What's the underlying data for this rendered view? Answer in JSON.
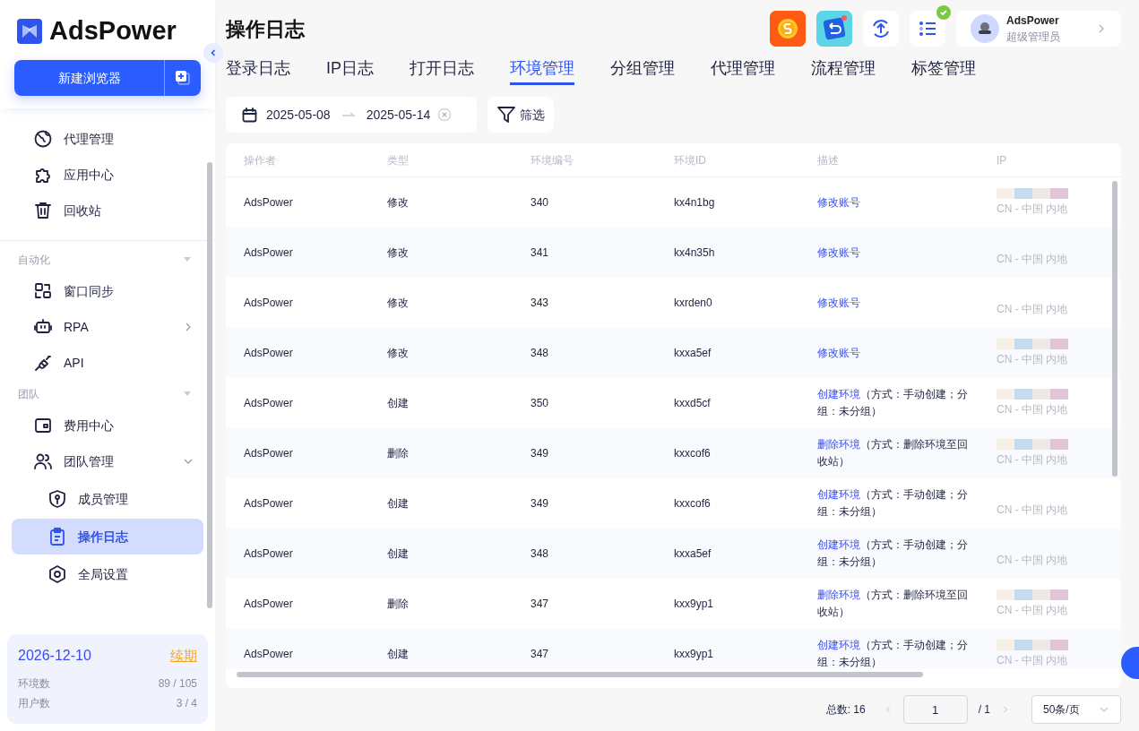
{
  "sidebar": {
    "brand": "AdsPower",
    "new_button": "新建浏览器",
    "items": [
      {
        "label": "代理管理",
        "selected": false
      },
      {
        "label": "应用中心",
        "selected": false
      },
      {
        "label": "回收站",
        "selected": false
      }
    ],
    "sections": [
      {
        "title": "自动化",
        "expanded": true,
        "items": [
          {
            "label": "窗口同步",
            "selected": false
          },
          {
            "label": "RPA",
            "selected": false,
            "expanded": false
          },
          {
            "label": "API",
            "selected": false
          }
        ]
      },
      {
        "title": "团队",
        "expanded": true,
        "items": [
          {
            "label": "费用中心",
            "selected": false
          },
          {
            "label": "团队管理",
            "selected": false,
            "expanded": true,
            "children": [
              {
                "label": "成员管理",
                "selected": false
              },
              {
                "label": "操作日志",
                "selected": true
              },
              {
                "label": "全局设置",
                "selected": false
              }
            ]
          }
        ]
      }
    ],
    "plan": {
      "expiry": "2026-12-10",
      "renew": "续期",
      "stats": [
        {
          "label": "环境数",
          "value": "89 / 105"
        },
        {
          "label": "用户数",
          "value": "3 / 4"
        }
      ]
    }
  },
  "header": {
    "title": "操作日志",
    "user": {
      "name": "AdsPower",
      "role": "超级管理员"
    }
  },
  "tabs": [
    {
      "label": "登录日志",
      "selected": false
    },
    {
      "label": "IP日志",
      "selected": false
    },
    {
      "label": "打开日志",
      "selected": false
    },
    {
      "label": "环境管理",
      "selected": true
    },
    {
      "label": "分组管理",
      "selected": false
    },
    {
      "label": "代理管理",
      "selected": false
    },
    {
      "label": "流程管理",
      "selected": false
    },
    {
      "label": "标签管理",
      "selected": false
    }
  ],
  "filter": {
    "start": "2025-05-08",
    "end": "2025-05-14",
    "filter_button": "筛选"
  },
  "table": {
    "columns": [
      "操作者",
      "类型",
      "环境编号",
      "环境ID",
      "描述",
      "IP"
    ],
    "rows": [
      {
        "operator": "AdsPower",
        "type": "修改",
        "number": "340",
        "env_id": "kx4n1bg",
        "action": "修改账号",
        "ip_redacted": true,
        "location": "CN - 中国 内地"
      },
      {
        "operator": "AdsPower",
        "type": "修改",
        "number": "341",
        "env_id": "kx4n35h",
        "action": "修改账号",
        "ip_redacted": false,
        "location": "CN - 中国 内地"
      },
      {
        "operator": "AdsPower",
        "type": "修改",
        "number": "343",
        "env_id": "kxrden0",
        "action": "修改账号",
        "ip_redacted": false,
        "location": "CN - 中国 内地"
      },
      {
        "operator": "AdsPower",
        "type": "修改",
        "number": "348",
        "env_id": "kxxa5ef",
        "action": "修改账号",
        "ip_redacted": true,
        "location": "CN - 中国 内地"
      },
      {
        "operator": "AdsPower",
        "type": "创建",
        "number": "350",
        "env_id": "kxxd5cf",
        "action": "创建环境",
        "detail": "（方式：手动创建；分组：未分组）",
        "ip_redacted": true,
        "location": "CN - 中国 内地"
      },
      {
        "operator": "AdsPower",
        "type": "删除",
        "number": "349",
        "env_id": "kxxcof6",
        "action": "删除环境",
        "detail": "（方式：删除环境至回收站）",
        "ip_redacted": true,
        "location": "CN - 中国 内地"
      },
      {
        "operator": "AdsPower",
        "type": "创建",
        "number": "349",
        "env_id": "kxxcof6",
        "action": "创建环境",
        "detail": "（方式：手动创建；分组：未分组）",
        "ip_redacted": false,
        "location": "CN - 中国 内地"
      },
      {
        "operator": "AdsPower",
        "type": "创建",
        "number": "348",
        "env_id": "kxxa5ef",
        "action": "创建环境",
        "detail": "（方式：手动创建；分组：未分组）",
        "ip_redacted": false,
        "location": "CN - 中国 内地"
      },
      {
        "operator": "AdsPower",
        "type": "删除",
        "number": "347",
        "env_id": "kxx9yp1",
        "action": "删除环境",
        "detail": "（方式：删除环境至回收站）",
        "ip_redacted": true,
        "location": "CN - 中国 内地"
      },
      {
        "operator": "AdsPower",
        "type": "创建",
        "number": "347",
        "env_id": "kxx9yp1",
        "action": "创建环境",
        "detail": "（方式：手动创建；分组：未分组）",
        "ip_redacted": true,
        "location": "CN - 中国 内地"
      }
    ]
  },
  "pagination": {
    "total": "总数: 16",
    "page": "1",
    "pages": "/ 1",
    "page_size": "50条/页"
  }
}
